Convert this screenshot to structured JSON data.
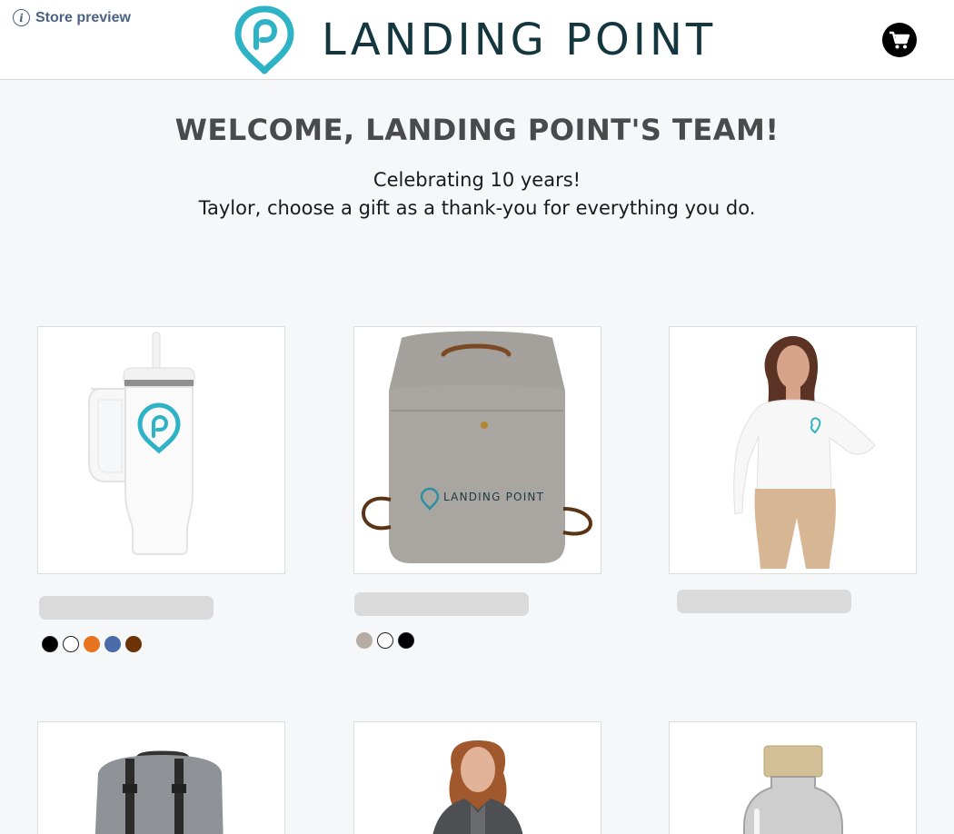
{
  "header": {
    "store_preview_label": "Store preview",
    "brand_name": "LANDING POINT",
    "brand_color": "#13363f",
    "logo_color": "#2eb3c6",
    "cart_icon": "shopping-cart-icon"
  },
  "hero": {
    "title": "WELCOME, LANDING POINT'S TEAM!",
    "line1": "Celebrating 10 years!",
    "line2": "Taylor, choose a gift as a thank-you for everything you do."
  },
  "products": [
    {
      "item": "tumbler",
      "swatches": [
        "#000000",
        "#ffffff",
        "#e8731f",
        "#4b6aa8",
        "#6b3306"
      ]
    },
    {
      "item": "canvas-bucket-backpack",
      "swatches": [
        "#b5ada3",
        "#ffffff",
        "#000000"
      ]
    },
    {
      "item": "white-button-up-shirt",
      "swatches": []
    },
    {
      "item": "gray-backpack",
      "swatches": []
    },
    {
      "item": "fleece-jacket",
      "swatches": []
    },
    {
      "item": "glass-bottle",
      "swatches": []
    }
  ],
  "bag_print": "LANDING POINT"
}
